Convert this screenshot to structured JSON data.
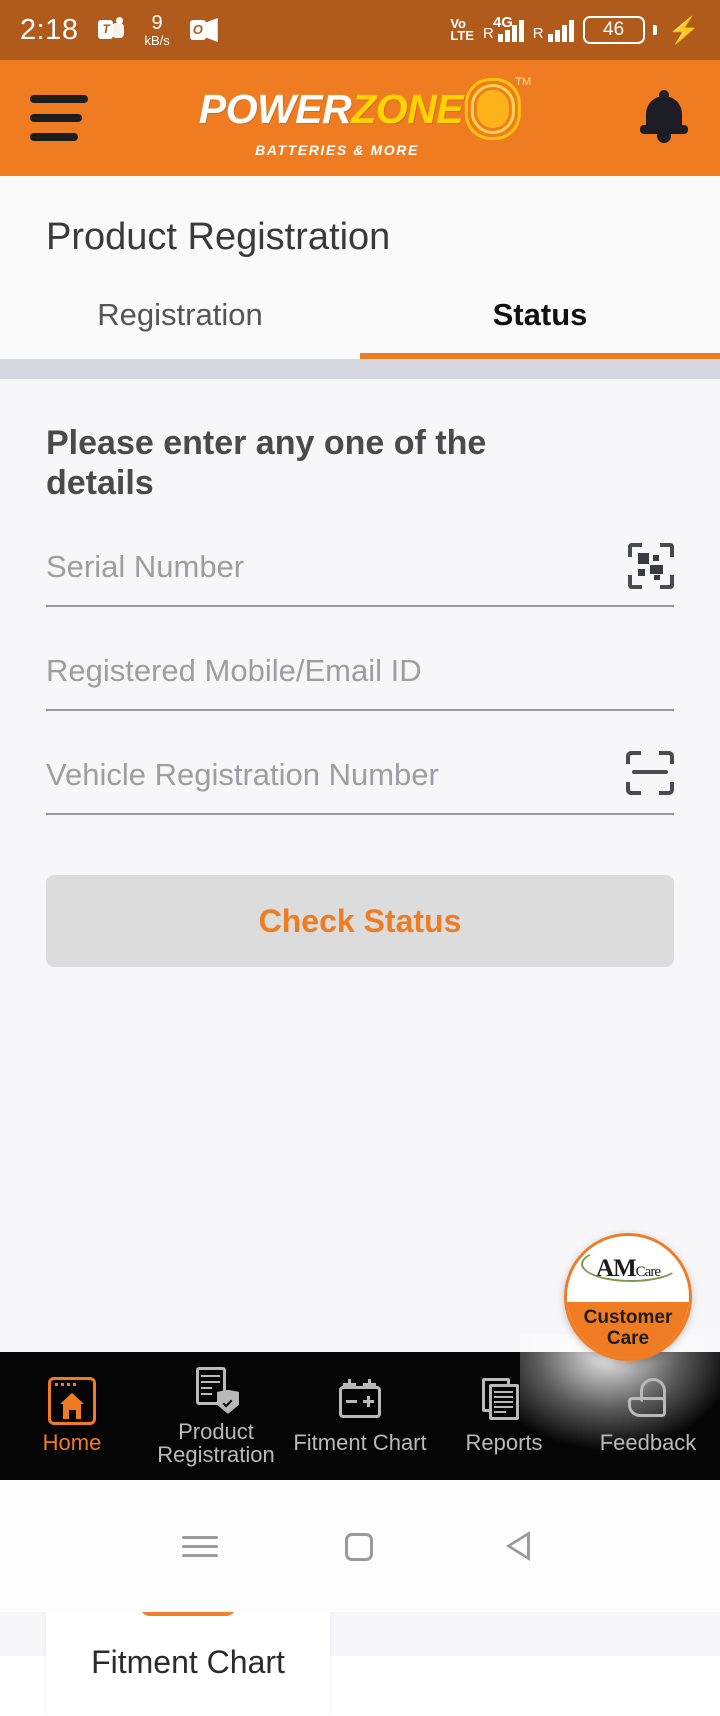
{
  "status_bar": {
    "time": "2:18",
    "icons": [
      "teams-icon",
      "data-speed",
      "outlook-icon"
    ],
    "data_speed_value": "9",
    "data_speed_unit": "kB/s",
    "volte_line1": "Vo",
    "volte_line2": "LTE",
    "network_type": "4G",
    "roaming_sim1": "R",
    "roaming_sim2": "R",
    "battery_percent": "46",
    "charging": true,
    "background_color": "#b05a1c"
  },
  "app_bar": {
    "menu_icon": "hamburger-menu-icon",
    "logo_power": "POWER",
    "logo_zone": "ZONE",
    "logo_tm": "TM",
    "logo_tagline": "BATTERIES & MORE",
    "notification_icon": "bell-icon",
    "background_color": "#f07c22"
  },
  "page": {
    "title": "Product Registration",
    "tabs": [
      {
        "label": "Registration",
        "active": false
      },
      {
        "label": "Status",
        "active": true
      }
    ],
    "accent_color": "#ef7c22"
  },
  "form": {
    "section_title": "Please enter any one of the details",
    "fields": [
      {
        "placeholder": "Serial Number",
        "value": "",
        "icon": "qr-scan-icon"
      },
      {
        "placeholder": "Registered Mobile/Email ID",
        "value": "",
        "icon": ""
      },
      {
        "placeholder": "Vehicle Registration Number",
        "value": "",
        "icon": "document-scan-icon"
      }
    ],
    "submit_label": "Check Status",
    "submit_bg": "#dcdcdc",
    "submit_color": "#ef7c22"
  },
  "tile": {
    "icon": "battery-icon",
    "label": "Fitment Chart"
  },
  "customer_care": {
    "logo_a": "A",
    "logo_m": "M",
    "logo_care": "Care",
    "line1": "Customer",
    "line2": "Care",
    "color": "#ef7c22"
  },
  "bottom_nav": {
    "items": [
      {
        "label": "Home",
        "icon": "home-icon",
        "active": true
      },
      {
        "label": "Product Registration",
        "icon": "document-shield-icon",
        "active": false
      },
      {
        "label": "Fitment Chart",
        "icon": "battery-outline-icon",
        "active": false
      },
      {
        "label": "Reports",
        "icon": "reports-pages-icon",
        "active": false
      },
      {
        "label": "Feedback",
        "icon": "thumbs-up-icon",
        "active": false
      }
    ],
    "background_color": "#050505",
    "active_color": "#ef7c22"
  },
  "android_nav": {
    "recents": "recents-icon",
    "home": "home-square-icon",
    "back": "back-triangle-icon"
  }
}
